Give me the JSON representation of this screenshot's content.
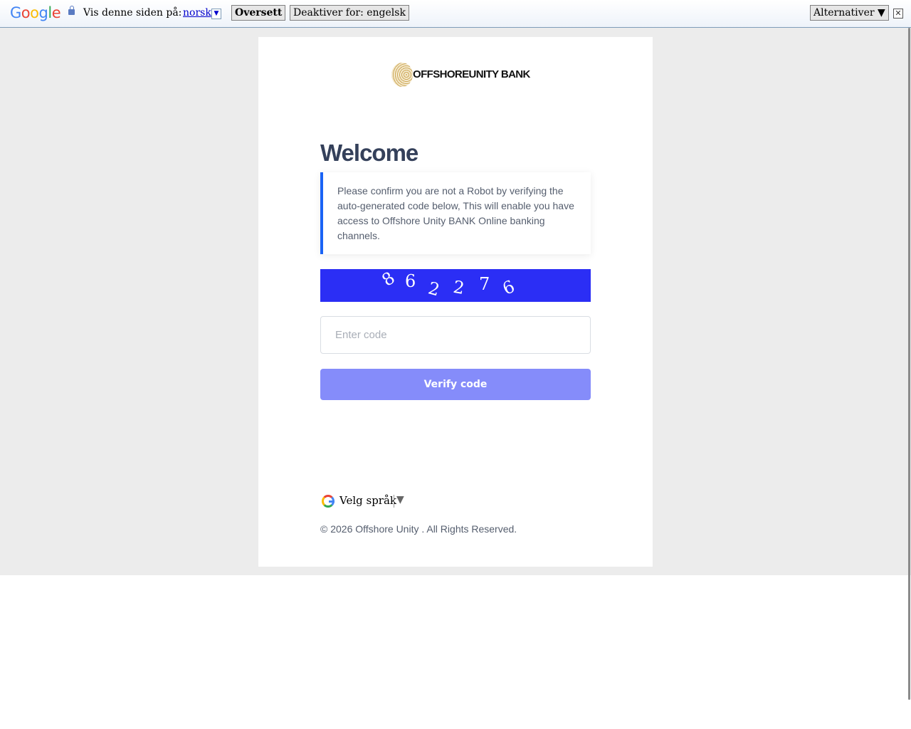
{
  "translate_bar": {
    "logo_letters": [
      "G",
      "o",
      "o",
      "g",
      "l",
      "e"
    ],
    "label": "Vis denne siden på:",
    "language": "norsk",
    "language_arrow": "▼",
    "translate_button": "Oversett",
    "disable_button": "Deaktiver for: engelsk",
    "options_button": "Alternativer ▼",
    "close_symbol": "✕"
  },
  "bank": {
    "logo_text": "OFFSHOREUNITY BANK",
    "welcome": "Welcome",
    "notice": "Please confirm you are not a Robot by verifying the auto-generated code below, This will enable you have access to Offshore Unity BANK Online banking channels.",
    "captcha_chars": [
      "8",
      "6",
      "2",
      "2",
      "7",
      "6"
    ],
    "code_placeholder": "Enter code",
    "verify_button": "Verify code",
    "language_select": "Velg språk",
    "language_arrow": "▼",
    "copyright": "© 2026 Offshore Unity . All Rights Reserved."
  },
  "colors": {
    "accent_blue": "#1a63f5",
    "captcha_bg": "#2b2ef5",
    "button_bg": "#858cfa",
    "page_bg": "#ececec"
  }
}
